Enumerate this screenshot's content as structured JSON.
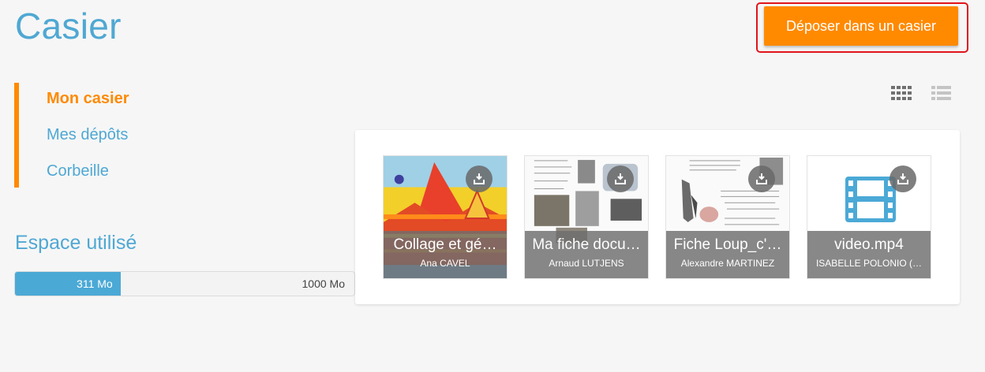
{
  "page": {
    "title": "Casier",
    "deposit_button": "Déposer dans un casier"
  },
  "sidebar": {
    "items": [
      {
        "label": "Mon casier",
        "active": true
      },
      {
        "label": "Mes dépôts",
        "active": false
      },
      {
        "label": "Corbeille",
        "active": false
      }
    ]
  },
  "storage": {
    "title": "Espace utilisé",
    "used_label": "311 Mo",
    "total_label": "1000 Mo",
    "used_fraction": 0.311
  },
  "view_toggle": {
    "icons": [
      "grid-view-icon",
      "list-view-icon"
    ],
    "selected": "grid"
  },
  "files": [
    {
      "name": "Collage et gé…",
      "author": "Ana CAVEL",
      "thumbnail": "image"
    },
    {
      "name": "Ma fiche docu…",
      "author": "Arnaud LUTJENS",
      "thumbnail": "document"
    },
    {
      "name": "Fiche Loup_c'…",
      "author": "Alexandre MARTINEZ",
      "thumbnail": "document"
    },
    {
      "name": "video.mp4",
      "author": "ISABELLE POLONIO (…",
      "thumbnail": "video-icon"
    }
  ],
  "colors": {
    "accent_orange": "#ff8a00",
    "accent_blue": "#4fa8d3",
    "highlight_red": "#e0151b"
  }
}
